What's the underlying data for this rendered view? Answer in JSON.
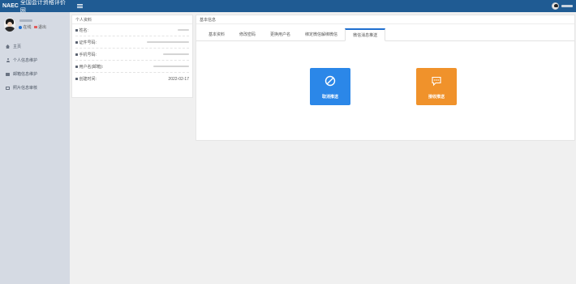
{
  "header": {
    "brand_bold": "NAEC",
    "brand_text": "全国会计资格评价网",
    "menu_icon": "hamburger-icon"
  },
  "sidebar": {
    "status": {
      "online": "在线",
      "logout": "退出"
    },
    "items": [
      {
        "label": "主页",
        "icon": "home-icon"
      },
      {
        "label": "个人信息维护",
        "icon": "user-icon"
      },
      {
        "label": "邮箱信息维护",
        "icon": "id-card-icon"
      },
      {
        "label": "照片信息审核",
        "icon": "image-icon"
      }
    ]
  },
  "profile": {
    "title": "个人资料",
    "rows": [
      {
        "label": "姓名:"
      },
      {
        "label": "证件号码:"
      },
      {
        "label": "手机号码:"
      },
      {
        "label": "用户名(邮箱):"
      },
      {
        "label": "创建时间:",
        "value": "2022-02-17"
      }
    ]
  },
  "basic": {
    "title": "基本信息",
    "tabs": [
      "基本资料",
      "修改密码",
      "更换用户名",
      "绑定微信解绑微信",
      "微信消息推送"
    ],
    "active_tab": 4,
    "tiles": {
      "cancel": {
        "label": "取消推送",
        "icon": "prohibited-icon",
        "color": "#2b87e8"
      },
      "accept": {
        "label": "接收推送",
        "icon": "message-icon",
        "color": "#f0922b"
      }
    }
  }
}
